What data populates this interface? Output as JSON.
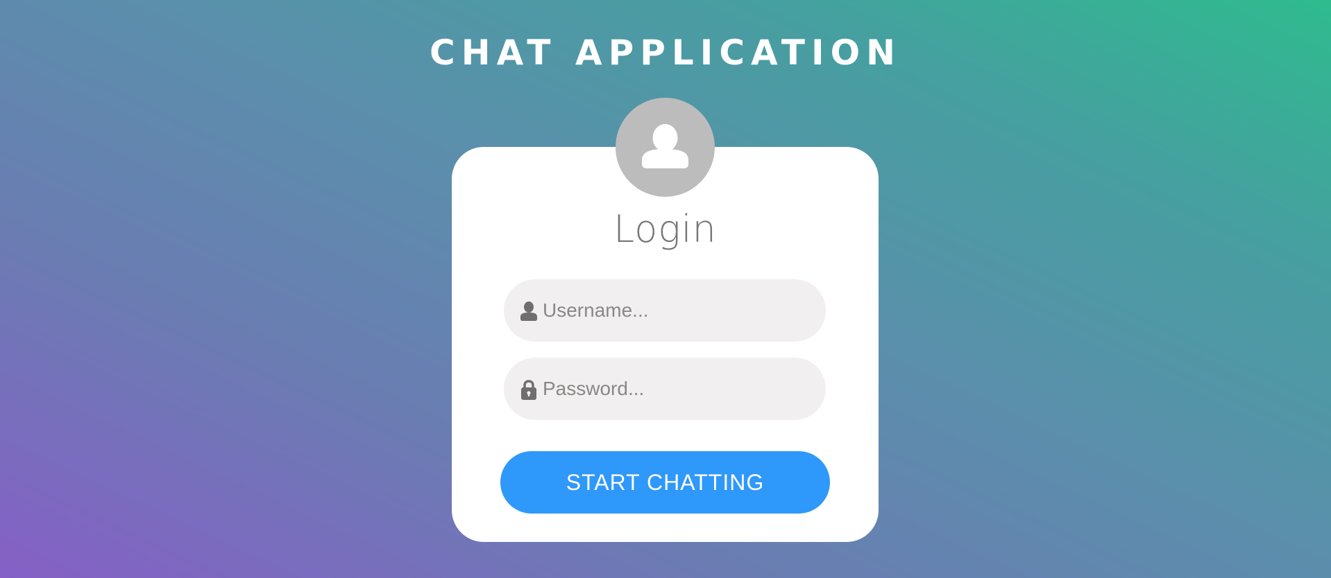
{
  "app": {
    "title": "CHAT APPLICATION"
  },
  "login_card": {
    "avatar_icon": "user-icon",
    "heading": "Login",
    "username": {
      "icon": "user-icon",
      "placeholder": "Username...",
      "value": ""
    },
    "password": {
      "icon": "lock-icon",
      "placeholder": "Password...",
      "value": ""
    },
    "submit_label": "START CHATTING"
  },
  "colors": {
    "gradient_start": "#8560c6",
    "gradient_end": "#2fbb8e",
    "card_background": "#ffffff",
    "avatar_background": "#bdbcbc",
    "input_background": "#f1efef",
    "button_background": "#2f98fb",
    "heading_text": "#767676",
    "title_text": "#ffffff"
  }
}
